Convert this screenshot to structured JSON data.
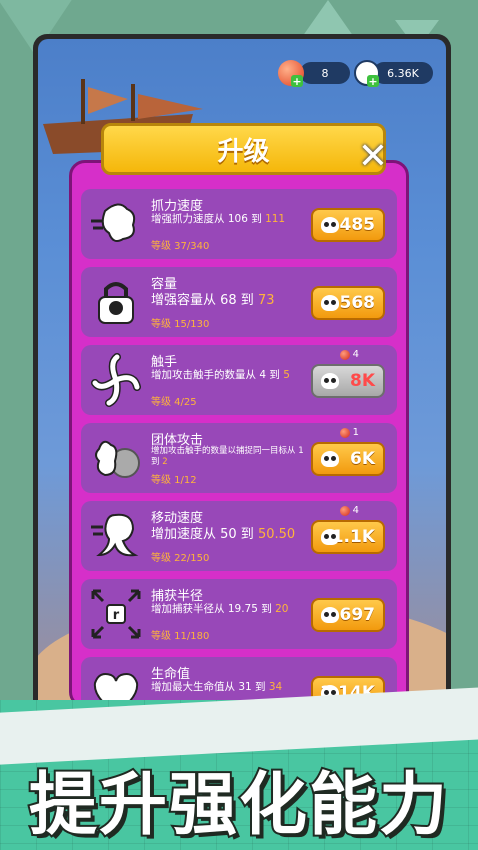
{
  "hud": {
    "gems_value": "8",
    "skulls_value": "6.36K",
    "gem_icon": "orange-ball-icon",
    "skull_icon": "skull-icon"
  },
  "dialog": {
    "title": "升级",
    "close_icon": "close-icon"
  },
  "upgrades": [
    {
      "title": "抓力速度",
      "desc_prefix": "增强抓力速度从 106 到 ",
      "desc_value": "111",
      "level": "等级 37/340",
      "cost": "485",
      "icon": "grab-speed-icon",
      "required": ""
    },
    {
      "title": "容量",
      "desc_prefix": "增强容量从 68 到 ",
      "desc_value": "73",
      "level": "等级 15/130",
      "cost": "568",
      "icon": "capacity-lock-icon",
      "required": ""
    },
    {
      "title": "触手",
      "desc_prefix": "增加攻击触手的数量从 4 到 ",
      "desc_value": "5",
      "level": "等级 4/25",
      "cost": "8K",
      "icon": "tentacle-icon",
      "required": "4",
      "disabled": true
    },
    {
      "title": "团体攻击",
      "desc_prefix": "增加攻击触手的数量以捕捉同一目标从 1 到 ",
      "desc_value": "2",
      "level": "等级 1/12",
      "cost": "6K",
      "icon": "group-attack-icon",
      "required": "1"
    },
    {
      "title": "移动速度",
      "desc_prefix": "增加速度从 50 到 ",
      "desc_value": "50.50",
      "level": "等级 22/150",
      "cost": "1.1K",
      "icon": "move-speed-icon",
      "required": "4"
    },
    {
      "title": "捕获半径",
      "desc_prefix": "增加捕获半径从 19.75 到 ",
      "desc_value": "20",
      "level": "等级 11/180",
      "cost": "697",
      "icon": "capture-radius-icon",
      "required": ""
    },
    {
      "title": "生命值",
      "desc_prefix": "增加最大生命值从 31 到 ",
      "desc_value": "34",
      "level": "",
      "cost": "1.14K",
      "icon": "heart-icon",
      "required": ""
    }
  ],
  "slogan": "提升强化能力",
  "colors": {
    "panel": "#d62fc9",
    "item": "#9848b8",
    "button": "#f5a81a",
    "highlight": "#ffb43a",
    "banner": "#f5b70a"
  }
}
